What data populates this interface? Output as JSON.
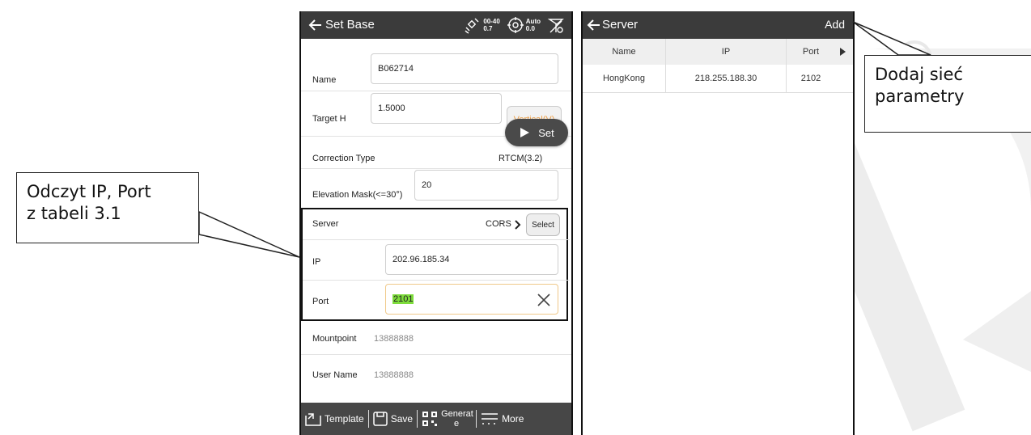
{
  "left_screen": {
    "title": "Set Base",
    "status": {
      "sat_top": "00-40",
      "sat_bottom": "0.7",
      "auto_top": "Auto",
      "auto_bottom": "0.0"
    },
    "name_label": "Name",
    "name_value": "B062714",
    "target_label": "Target H",
    "target_value": "1.5000",
    "vertical_button": "Vertical(V)",
    "set_button": "Set",
    "correction_label": "Correction Type",
    "correction_value": "RTCM(3.2)",
    "elevation_label": "Elevation Mask(<=30°)",
    "elevation_value": "20",
    "server_label": "Server",
    "server_value": "CORS",
    "select_button": "Select",
    "ip_label": "IP",
    "ip_value": "202.96.185.34",
    "port_label": "Port",
    "port_value": "2101",
    "mountpoint_label": "Mountpoint",
    "mountpoint_value": "13888888",
    "username_label": "User Name",
    "username_value": "13888888",
    "bottom_bar": {
      "template": "Template",
      "save": "Save",
      "generate": "Generat e",
      "more": "More"
    }
  },
  "right_screen": {
    "title": "Server",
    "add_button": "Add",
    "columns": [
      "Name",
      "IP",
      "Port"
    ],
    "rows": [
      {
        "name": "HongKong",
        "ip": "218.255.188.30",
        "port": "2102"
      }
    ]
  },
  "callouts": {
    "left_line1": "Odczyt IP, Port",
    "left_line2": "z tabeli 3.1",
    "right_line1": "Dodaj sieć",
    "right_line2": "parametry"
  },
  "colors": {
    "titlebar": "#3b3b3b",
    "bottombar": "#474747",
    "accent_orange": "#f0a24a",
    "port_highlight": "#7ddc3b"
  }
}
